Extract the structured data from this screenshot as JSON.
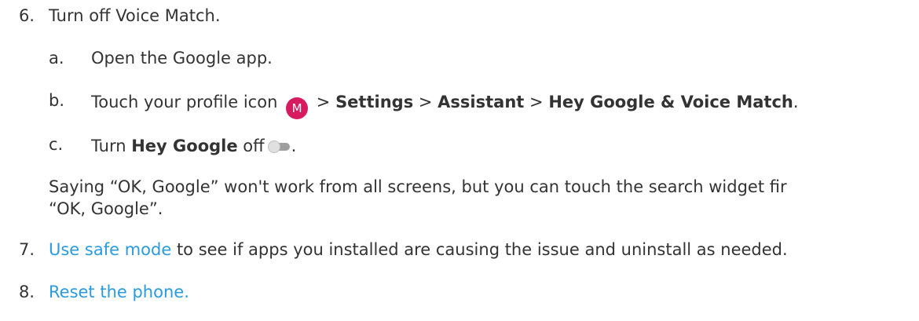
{
  "steps": [
    {
      "num": "6.",
      "text": "Turn off Voice Match."
    },
    {
      "num": "7.",
      "link": "Use safe mode",
      "text": " to see if apps you installed are causing the issue and uninstall as needed."
    },
    {
      "num": "8.",
      "link": "Reset the phone."
    }
  ],
  "substeps": {
    "a": {
      "label": "a.",
      "text": "Open the Google app."
    },
    "b": {
      "label": "b.",
      "prefix": "Touch your profile icon",
      "avatar_letter": "M",
      "sep": ">",
      "settings": "Settings",
      "assistant": "Assistant",
      "voice_match": "Hey Google & Voice Match",
      "end": "."
    },
    "c": {
      "label": "c.",
      "prefix": "Turn",
      "bold": "Hey Google",
      "suffix": "off",
      "end": "."
    }
  },
  "note": {
    "line1": "Saying “OK, Google” won't work from all screens, but you can touch the search widget fir",
    "line2": "“OK, Google”."
  },
  "colors": {
    "text": "#333333",
    "link": "#2a9be0",
    "avatar": "#d81b60",
    "toggle_track": "#9e9e9e"
  },
  "icons": [
    "profile-avatar-icon",
    "toggle-off-icon"
  ]
}
